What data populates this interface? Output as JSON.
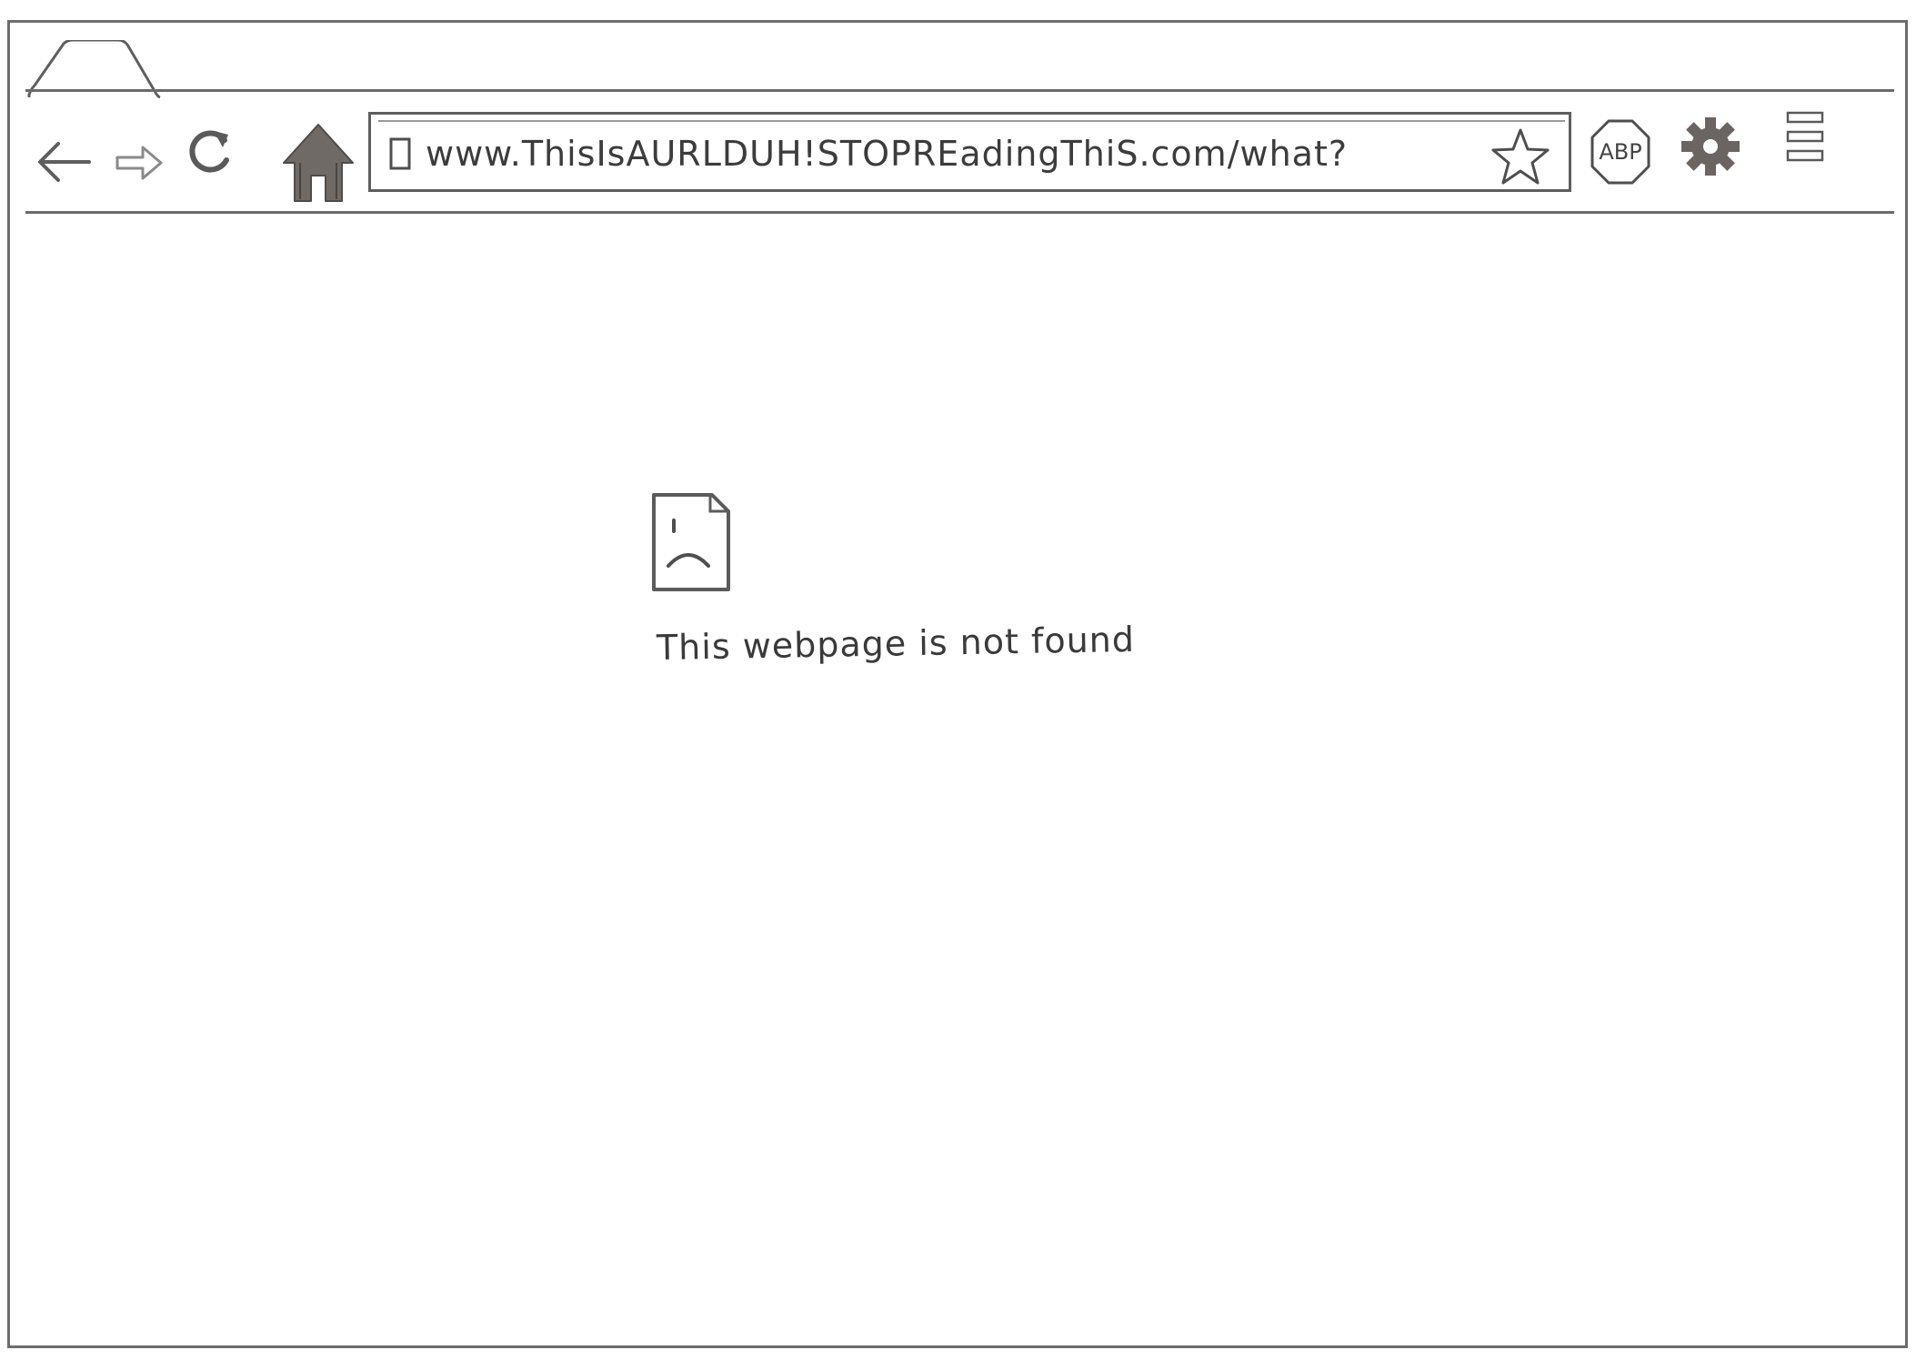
{
  "browser": {
    "toolbar": {
      "back_icon": "back-arrow-icon",
      "forward_icon": "forward-arrow-icon",
      "reload_icon": "reload-icon",
      "home_icon": "home-icon"
    },
    "omnibox": {
      "url": "www.ThisIsAURLDUH!STOPREadingThiS.com/what?",
      "page_icon": "page-icon",
      "bookmark_icon": "star-icon"
    },
    "extensions": {
      "adblock_label": "ABP",
      "settings_icon": "gear-icon",
      "menu_icon": "menu-icon"
    }
  },
  "content": {
    "error_icon": "sad-page-icon",
    "error_message": "This webpage is not found"
  },
  "colors": {
    "ink": "#5e5e5e",
    "fill_dark": "#6f6a66"
  }
}
